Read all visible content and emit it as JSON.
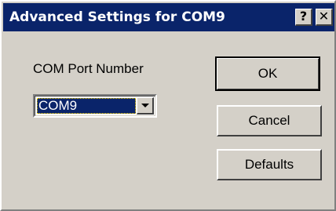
{
  "window": {
    "title": "Advanced Settings for COM9",
    "help_label": "?",
    "close_label": "✕"
  },
  "form": {
    "port_label": "COM Port Number",
    "port_value": "COM9"
  },
  "buttons": {
    "ok_label": "OK",
    "cancel_label": "Cancel",
    "defaults_label": "Defaults"
  },
  "colors": {
    "titlebar": "#0a246a",
    "face": "#d4d0c8",
    "selection": "#0a246a"
  },
  "icons": {
    "help": "help-icon",
    "close": "close-icon",
    "dropdown": "chevron-down-icon"
  }
}
